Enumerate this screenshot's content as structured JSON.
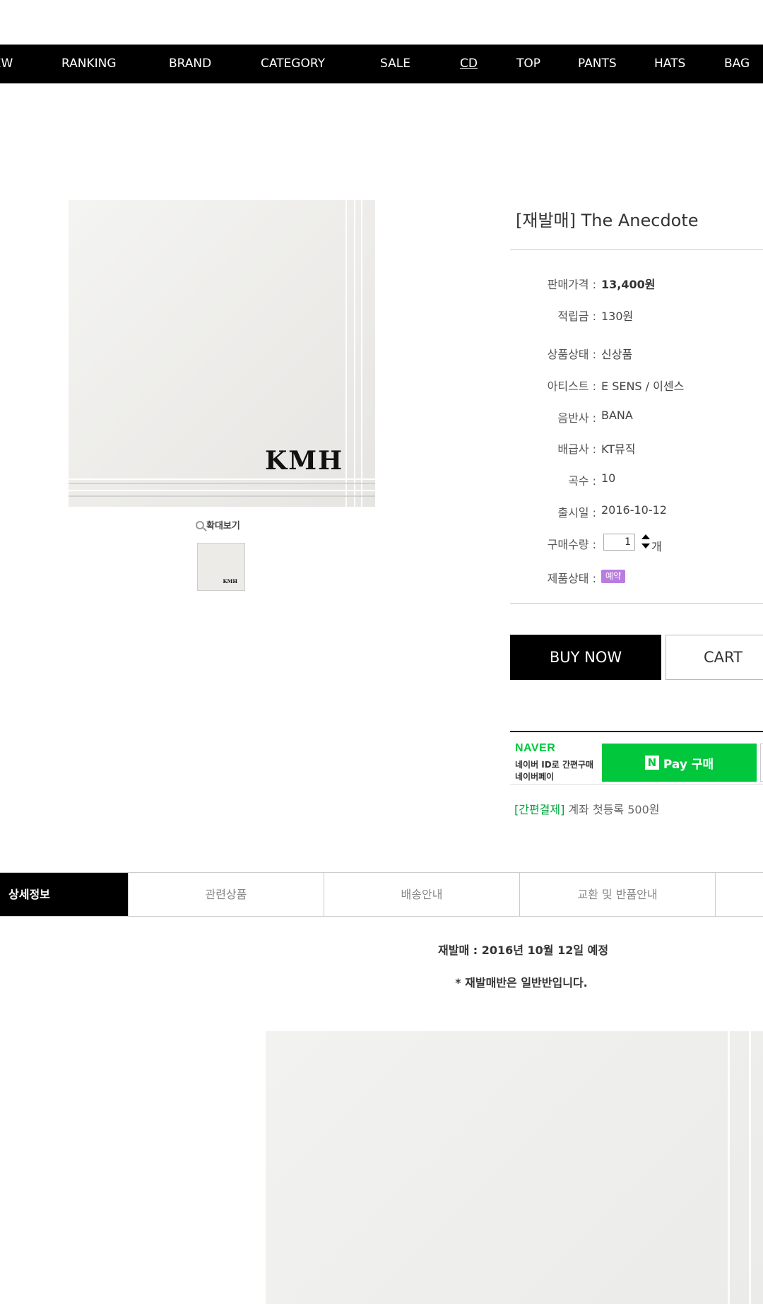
{
  "nav": {
    "items": [
      {
        "label": "NEW"
      },
      {
        "label": "RANKING"
      },
      {
        "label": "BRAND"
      },
      {
        "label": "CATEGORY"
      },
      {
        "label": "SALE"
      },
      {
        "label": "CD",
        "active": true
      },
      {
        "label": "TOP"
      },
      {
        "label": "PANTS"
      },
      {
        "label": "HATS"
      },
      {
        "label": "BAG"
      }
    ]
  },
  "gallery": {
    "image_logo": "KMH",
    "zoom_label": "확대보기",
    "thumb_logo": "KMH"
  },
  "product": {
    "title": "[재발매] The Anecdote",
    "rows": [
      {
        "label": "판매가격 :",
        "value": "13,400원"
      },
      {
        "label": "적립금 :",
        "value": "130원"
      },
      {
        "label": "상품상태 :",
        "value": "신상품"
      },
      {
        "label": "아티스트 :",
        "value": "E SENS / 이센스"
      },
      {
        "label": "음반사 :",
        "value": "BANA"
      },
      {
        "label": "배급사 :",
        "value": "KT뮤직"
      },
      {
        "label": "곡수 :",
        "value": "10"
      },
      {
        "label": "출시일 :",
        "value": "2016-10-12"
      }
    ],
    "quantity": {
      "label": "구매수량 :",
      "value": "1",
      "unit": "개"
    },
    "status": {
      "label": "제품상태 :",
      "badge": "예약",
      "badge_color": "#b97de0"
    }
  },
  "buttons": {
    "buy": "BUY NOW",
    "cart": "CART"
  },
  "naver": {
    "logo": "NAVER",
    "sub1": "네이버 ID로 간편구매",
    "sub2": "네이버페이",
    "pay_n": "N",
    "pay_label": "Pay 구매",
    "brand_color": "#00c73c"
  },
  "easypay": {
    "tag": "[간편결제]",
    "text": " 계좌 첫등록 500원"
  },
  "tabs": [
    {
      "label": "상세정보",
      "active": true
    },
    {
      "label": "관련상품"
    },
    {
      "label": "배송안내"
    },
    {
      "label": "교환 및 반품안내"
    }
  ],
  "detail": {
    "notice1": "재발매 : 2016년 10월 12일 예정",
    "notice2": "* 재발매반은 일반반입니다."
  }
}
